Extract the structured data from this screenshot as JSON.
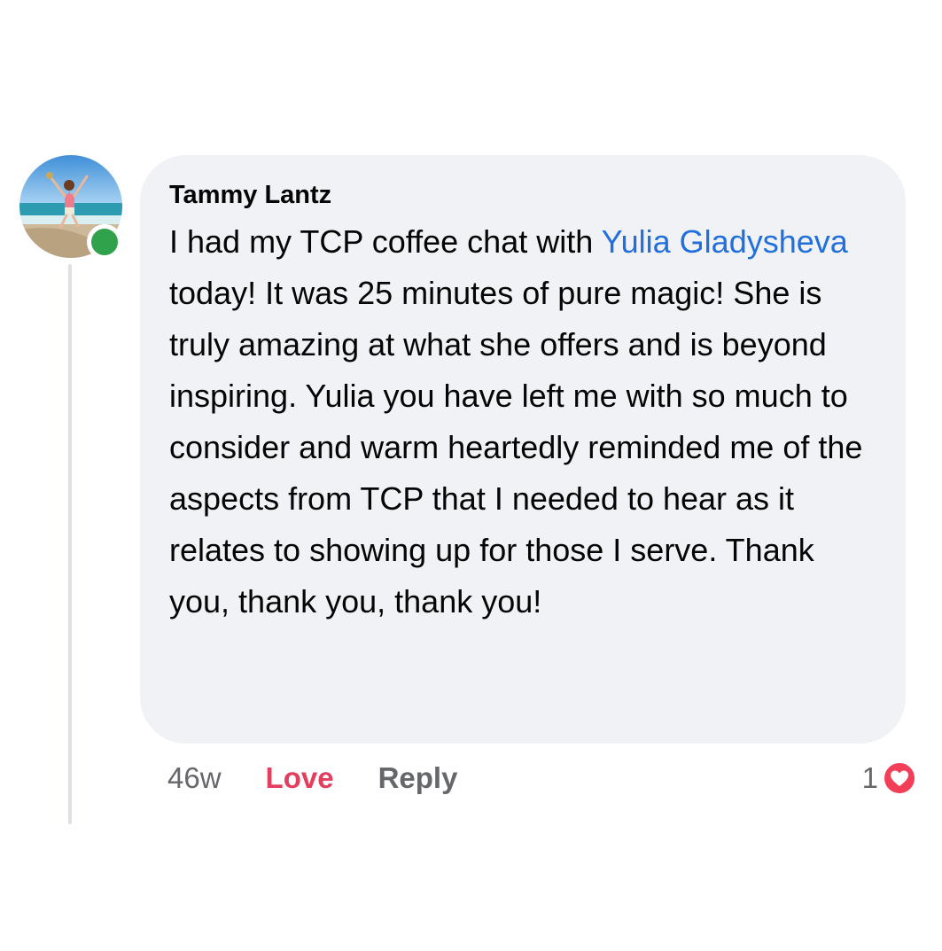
{
  "comment": {
    "author": "Tammy Lantz",
    "body_parts": [
      "I had my TCP coffee chat with ",
      "Yulia Gladysheva",
      " today! It was 25 minutes of pure magic! She is truly amazing at what she offers and is beyond inspiring. Yulia you have left me with so much to consider and warm heartedly reminded me of the aspects from TCP that I needed to hear as it relates to showing up for those I serve. Thank you, thank you, thank you!"
    ],
    "timestamp": "46w",
    "love_label": "Love",
    "reply_label": "Reply",
    "reaction_count": "1",
    "reaction_icon": "love-heart-icon"
  },
  "colors": {
    "bubble_bg": "#f0f2f5",
    "mention": "#216fdb",
    "love": "#e43d5d",
    "online": "#31a24c",
    "muted_text": "#65676b"
  }
}
